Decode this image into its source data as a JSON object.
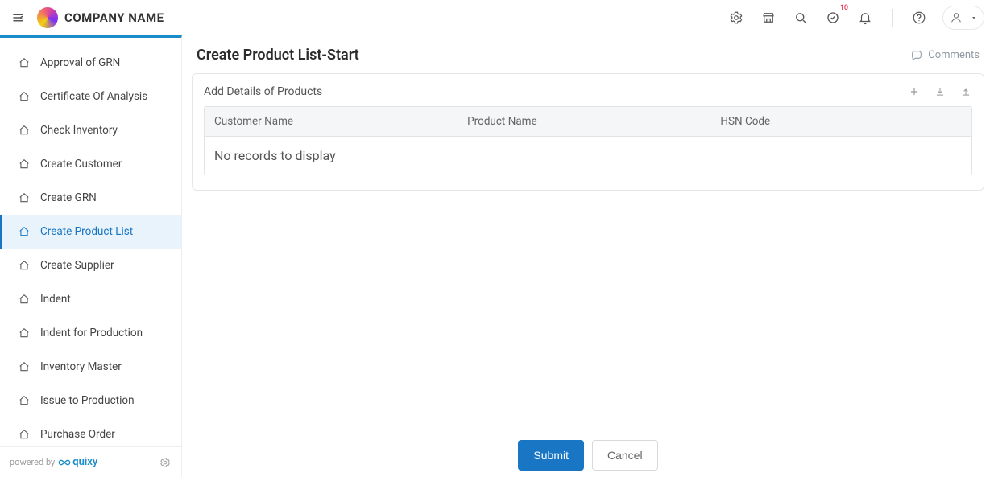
{
  "brand": "COMPANY NAME",
  "topbar": {
    "notifications_badge": "10"
  },
  "sidebar": {
    "items": [
      {
        "label": "Approval of GRN"
      },
      {
        "label": "Certificate Of Analysis"
      },
      {
        "label": "Check Inventory"
      },
      {
        "label": "Create Customer"
      },
      {
        "label": "Create GRN"
      },
      {
        "label": "Create Product List"
      },
      {
        "label": "Create Supplier"
      },
      {
        "label": "Indent"
      },
      {
        "label": "Indent for Production"
      },
      {
        "label": "Inventory Master"
      },
      {
        "label": "Issue to Production"
      },
      {
        "label": "Purchase Order"
      }
    ],
    "active_index": 5,
    "powered_by_prefix": "powered by",
    "powered_by_name": "quixy"
  },
  "page": {
    "title": "Create Product List-Start",
    "comments_label": "Comments",
    "section_title": "Add Details of Products",
    "columns": [
      "Customer Name",
      "Product Name",
      "HSN Code"
    ],
    "empty_text": "No records to display",
    "submit_label": "Submit",
    "cancel_label": "Cancel"
  }
}
